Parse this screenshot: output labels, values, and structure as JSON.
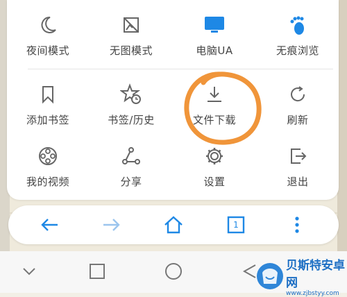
{
  "menu": {
    "items": [
      {
        "label": "夜间模式",
        "icon": "moon-icon"
      },
      {
        "label": "无图模式",
        "icon": "no-image-icon"
      },
      {
        "label": "电脑UA",
        "icon": "desktop-icon"
      },
      {
        "label": "无痕浏览",
        "icon": "footprint-icon"
      },
      {
        "label": "添加书签",
        "icon": "bookmark-icon"
      },
      {
        "label": "书签/历史",
        "icon": "bookmark-history-icon"
      },
      {
        "label": "文件下载",
        "icon": "download-icon"
      },
      {
        "label": "刷新",
        "icon": "refresh-icon"
      },
      {
        "label": "我的视频",
        "icon": "film-reel-icon"
      },
      {
        "label": "分享",
        "icon": "share-icon"
      },
      {
        "label": "设置",
        "icon": "gear-icon"
      },
      {
        "label": "退出",
        "icon": "exit-icon"
      }
    ]
  },
  "toolbar": {
    "items": [
      "back-icon",
      "forward-icon",
      "home-icon",
      "tabs-icon",
      "more-icon"
    ],
    "tab_count": "1"
  },
  "navbar": {
    "items": [
      "nav-back-icon",
      "recent-apps-icon",
      "home-circle-icon",
      "nav-triangle-icon"
    ]
  },
  "watermark": {
    "title": "贝斯特安卓网",
    "url": "www.zjbstyy.com"
  },
  "colors": {
    "accent": "#1e88e5",
    "icon_gray": "#666666",
    "highlight_orange": "#f0953a"
  }
}
